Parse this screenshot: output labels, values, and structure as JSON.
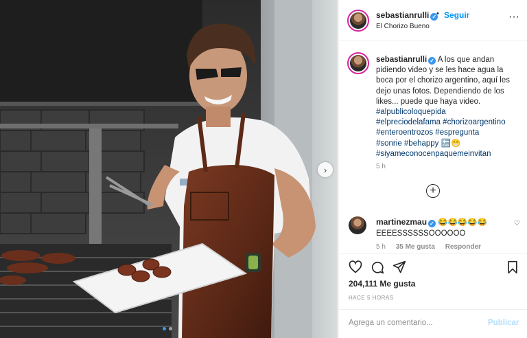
{
  "post": {
    "username": "sebastianrulli",
    "follow_label": "Seguir",
    "separator": "•",
    "location": "El Chorizo Bueno",
    "more_glyph": "···",
    "verified_glyph": "✓"
  },
  "caption": {
    "username": "sebastianrulli",
    "text": "A los que andan pidiendo video y se les hace agua la boca por el chorizo argentino, aquí les dejo unas fotos. Dependiendo de los likes... puede que haya video.",
    "hashtag_lines": [
      "#alpublicoloquepida",
      "#elpreciodelafama #chorizoargentino",
      "#enteroentrozos #espregunta",
      "#sonrie #behappy 🔚😁",
      "#siyameconocenpaquemeinvitan"
    ],
    "time": "5 h"
  },
  "load_more_glyph": "+",
  "comments": [
    {
      "username": "martinezmau",
      "emojis": "😂😂😂😂😂",
      "text": "EEEESSSSSSOOOOOO",
      "time": "5 h",
      "likes": "35 Me gusta",
      "reply": "Responder"
    }
  ],
  "actions": {
    "likes": "204,111 Me gusta",
    "posted_ago": "HACE 5 HORAS"
  },
  "comment_box": {
    "placeholder": "Agrega un comentario...",
    "post_label": "Publicar"
  },
  "photo": {
    "next_glyph": "›",
    "carousel_dots": 2,
    "active_dot": 0
  },
  "colors": {
    "link_blue": "#0095f6",
    "hashtag_blue": "#00376b",
    "muted": "#8e8e8e",
    "disabled_blue": "#b2dffc"
  }
}
